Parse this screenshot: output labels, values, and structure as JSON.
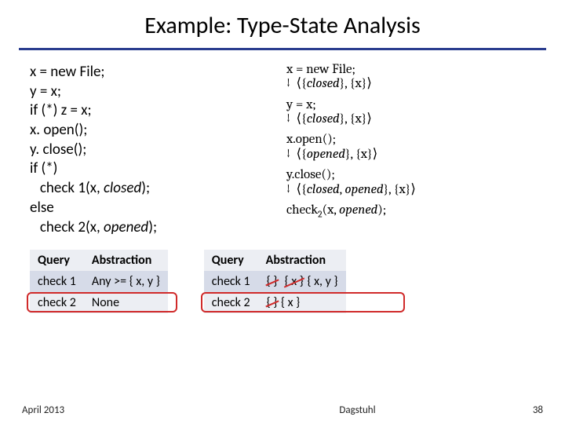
{
  "title": "Example: Type-State Analysis",
  "code": {
    "l1": "x = new File;",
    "l2": "y = x;",
    "l3": "if (*) z = x;",
    "l4": "x. open();",
    "l5": "y. close();",
    "l6": "if (*)",
    "l7_pre": "   check 1(x, ",
    "l7_it": "closed",
    "l7_post": ");",
    "l8": "else",
    "l9_pre": "   check 2(x, ",
    "l9_it": "opened",
    "l9_post": ");"
  },
  "trace": {
    "s1": "x = new File;",
    "a1_pre": "↓  ⟨{",
    "a1_it": "closed",
    "a1_post": "}, {x}⟩",
    "s2": "y = x;",
    "a2_pre": "↓  ⟨{",
    "a2_it": "closed",
    "a2_post": "}, {x}⟩",
    "s3": "x.open();",
    "a3_pre": "↓  ⟨{",
    "a3_it": "opened",
    "a3_post": "}, {x}⟩",
    "s4": "y.close();",
    "a4_pre": "↓  ⟨{",
    "a4_it1": "closed",
    "a4_mid": ", ",
    "a4_it2": "opened",
    "a4_post": "}, {x}⟩",
    "s5_pre": "check",
    "s5_sub": "2",
    "s5_post": "(x, ",
    "s5_it": "opened",
    "s5_end": ");"
  },
  "table_left": {
    "h1": "Query",
    "h2": "Abstraction",
    "r1c1": "check 1",
    "r1c2": "Any >= { x, y }",
    "r2c1": "check 2",
    "r2c2": "None"
  },
  "table_right": {
    "h1": "Query",
    "h2": "Abstraction",
    "r1c1": "check 1",
    "r1_s1": "{ }",
    "r1_s2": "{ x }",
    "r1_rest": " { x, y }",
    "r2c1": "check 2",
    "r2_s1": "{ }",
    "r2_rest": " { x }"
  },
  "footer": {
    "date": "April 2013",
    "venue": "Dagstuhl",
    "page": "38"
  }
}
